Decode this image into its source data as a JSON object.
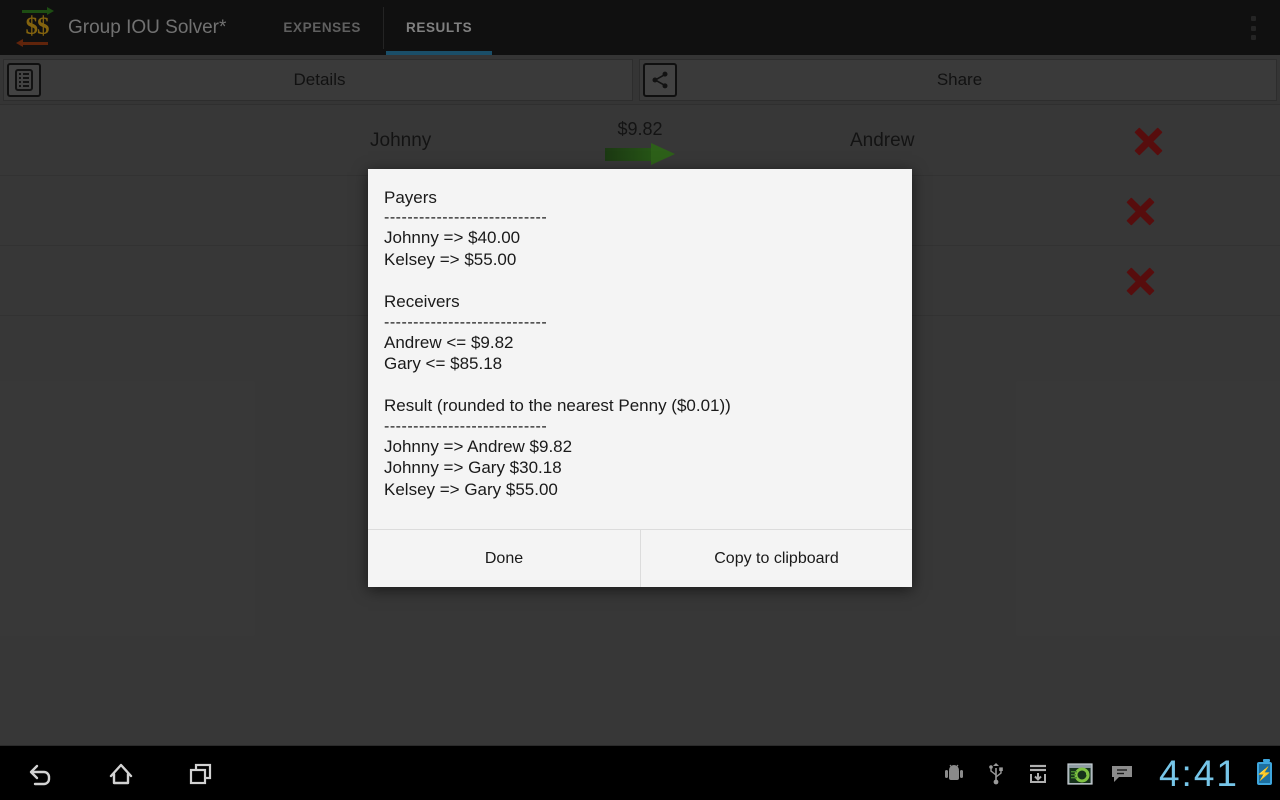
{
  "app": {
    "title": "Group IOU Solver*",
    "logo_icon": "double-dollar-exchange-icon",
    "overflow_icon": "overflow-menu-icon"
  },
  "tabs": [
    {
      "label": "EXPENSES",
      "active": false
    },
    {
      "label": "RESULTS",
      "active": true
    }
  ],
  "accent_color": "#2a7ea8",
  "sub_bar": {
    "details_label": "Details",
    "details_icon": "list-icon",
    "share_label": "Share",
    "share_icon": "share-icon"
  },
  "rows": [
    {
      "payer": "Johnny",
      "amount": "$9.82",
      "receiver": "Andrew",
      "delete_icon": "close-x-icon"
    },
    {
      "payer": "",
      "amount": "",
      "receiver": "",
      "delete_icon": "close-x-icon"
    },
    {
      "payer": "",
      "amount": "",
      "receiver": "",
      "delete_icon": "close-x-icon"
    }
  ],
  "dialog": {
    "lines": [
      "Payers",
      "----------------------------",
      "Johnny => $40.00",
      "Kelsey => $55.00",
      "",
      "Receivers",
      "----------------------------",
      "Andrew <= $9.82",
      "Gary <= $85.18",
      "",
      "Result (rounded to the nearest Penny ($0.01))",
      "----------------------------",
      "Johnny => Andrew $9.82",
      "Johnny => Gary $30.18",
      "Kelsey => Gary $55.00"
    ],
    "buttons": [
      {
        "label": "Done",
        "name": "done-button"
      },
      {
        "label": "Copy to clipboard",
        "name": "copy-to-clipboard-button"
      }
    ]
  },
  "nav": {
    "back_icon": "back-arrow-icon",
    "home_icon": "home-icon",
    "recents_icon": "recent-apps-icon",
    "status_icons": [
      "android-debug-icon",
      "usb-icon",
      "download-icon",
      "screenshot-app-icon",
      "message-bubble-icon"
    ],
    "clock": "4:41",
    "battery_icon": "battery-charging-icon",
    "battery_color": "#3ea6dd"
  }
}
